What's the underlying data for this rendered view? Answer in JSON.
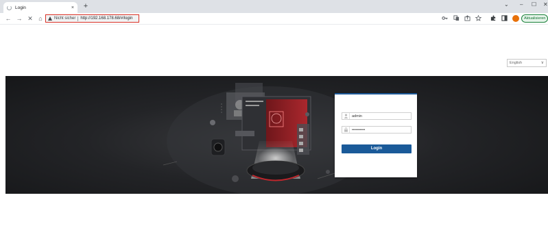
{
  "browser": {
    "tab": {
      "title": "Login",
      "close_glyph": "×"
    },
    "new_tab_glyph": "+",
    "window_controls": {
      "tabsearch": "⌄",
      "minimize": "–",
      "maximize": "☐",
      "close": "✕"
    },
    "nav": {
      "back": "←",
      "forward": "→",
      "stop": "✕",
      "home": "⌂"
    },
    "omnibox": {
      "security_text": "Nicht sicher",
      "url": "http://192.168.178.68/#/login"
    },
    "profile_initial": "",
    "update_label": "Aktualisieren",
    "toolbar_icons": [
      "key-icon",
      "translate-icon",
      "share-icon",
      "star-icon",
      "puzzle-icon",
      "sidepanel-icon"
    ]
  },
  "page": {
    "language": {
      "selected": "English",
      "chevron": "∨"
    },
    "login": {
      "username": "admin",
      "password": "••••••••••",
      "button_label": "Login"
    },
    "colors": {
      "accent": "#1a5a99",
      "banner_dark": "#1b1c1f",
      "alert": "#d93025"
    }
  }
}
